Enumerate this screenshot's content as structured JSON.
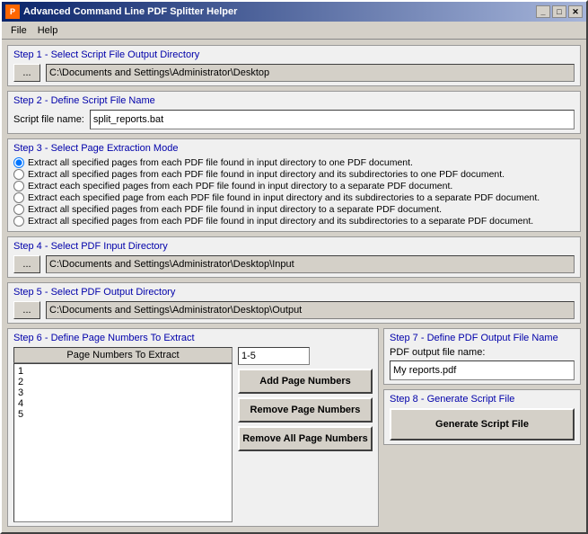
{
  "window": {
    "title": "Advanced Command Line PDF Splitter Helper",
    "icon": "pdf-icon"
  },
  "menu": {
    "items": [
      {
        "label": "File"
      },
      {
        "label": "Help"
      }
    ]
  },
  "step1": {
    "title": "Step 1 - Select Script File Output Directory",
    "browse_label": "...",
    "path": "C:\\Documents and Settings\\Administrator\\Desktop"
  },
  "step2": {
    "title": "Step 2 - Define Script File Name",
    "field_label": "Script file name:",
    "value": "split_reports.bat"
  },
  "step3": {
    "title": "Step 3 - Select Page Extraction Mode",
    "options": [
      "Extract all specified pages from each PDF file found in input directory to one PDF document.",
      "Extract all specified pages from each PDF file found in input directory and its subdirectories to one PDF document.",
      "Extract each specified pages from each PDF file found in input directory to a separate PDF document.",
      "Extract each specified page from each PDF file found in input directory and its subdirectories to a separate PDF document.",
      "Extract all specified pages from each PDF file found in input directory to a separate PDF document.",
      "Extract all specified pages from each PDF file found in input directory and its subdirectories to a separate PDF document."
    ],
    "selected": 0
  },
  "step4": {
    "title": "Step 4 - Select PDF Input Directory",
    "browse_label": "...",
    "path": "C:\\Documents and Settings\\Administrator\\Desktop\\Input"
  },
  "step5": {
    "title": "Step 5 - Select PDF Output Directory",
    "browse_label": "...",
    "path": "C:\\Documents and Settings\\Administrator\\Desktop\\Output"
  },
  "step6": {
    "title": "Step 6 - Define Page Numbers To Extract",
    "list_header": "Page Numbers To Extract",
    "page_numbers": [
      "1",
      "2",
      "3",
      "4",
      "5"
    ],
    "input_value": "1-5",
    "add_label": "Add Page Numbers",
    "remove_label": "Remove Page Numbers",
    "remove_all_label": "Remove All Page Numbers"
  },
  "step7": {
    "title": "Step 7 - Define PDF Output File Name",
    "field_label": "PDF output file name:",
    "value": "My reports.pdf"
  },
  "step8": {
    "title": "Step 8 - Generate Script File",
    "generate_label": "Generate Script File"
  },
  "title_buttons": {
    "minimize": "_",
    "maximize": "□",
    "close": "✕"
  }
}
